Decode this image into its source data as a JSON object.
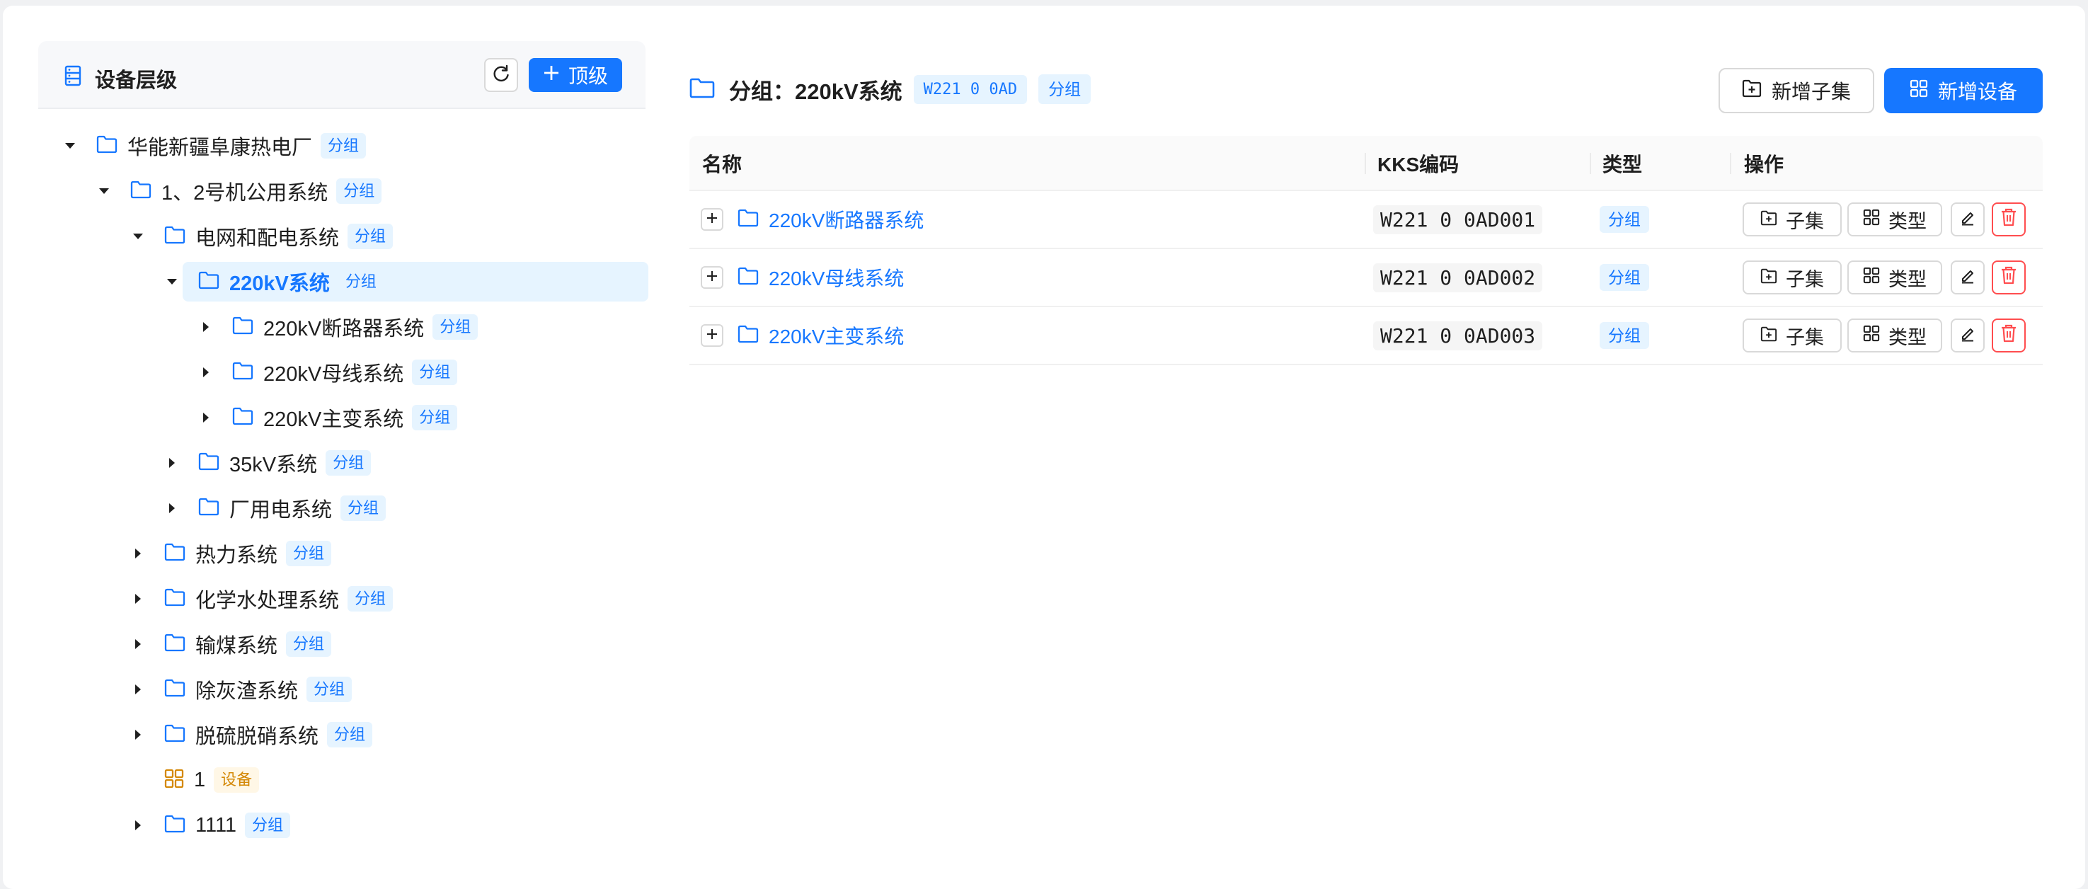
{
  "left": {
    "title": "设备层级",
    "top_button_label": "顶级"
  },
  "tree": [
    {
      "label": "华能新疆阜康热电厂",
      "tag": "分组",
      "kind": "group",
      "expanded": true,
      "depth": 0
    },
    {
      "label": "1、2号机公用系统",
      "tag": "分组",
      "kind": "group",
      "expanded": true,
      "depth": 1
    },
    {
      "label": "电网和配电系统",
      "tag": "分组",
      "kind": "group",
      "expanded": true,
      "depth": 2
    },
    {
      "label": "220kV系统",
      "tag": "分组",
      "kind": "group",
      "expanded": true,
      "depth": 3,
      "selected": true
    },
    {
      "label": "220kV断路器系统",
      "tag": "分组",
      "kind": "group",
      "expanded": false,
      "depth": 4
    },
    {
      "label": "220kV母线系统",
      "tag": "分组",
      "kind": "group",
      "expanded": false,
      "depth": 4
    },
    {
      "label": "220kV主变系统",
      "tag": "分组",
      "kind": "group",
      "expanded": false,
      "depth": 4
    },
    {
      "label": "35kV系统",
      "tag": "分组",
      "kind": "group",
      "expanded": false,
      "depth": 3
    },
    {
      "label": "厂用电系统",
      "tag": "分组",
      "kind": "group",
      "expanded": false,
      "depth": 3
    },
    {
      "label": "热力系统",
      "tag": "分组",
      "kind": "group",
      "expanded": false,
      "depth": 2
    },
    {
      "label": "化学水处理系统",
      "tag": "分组",
      "kind": "group",
      "expanded": false,
      "depth": 2
    },
    {
      "label": "输煤系统",
      "tag": "分组",
      "kind": "group",
      "expanded": false,
      "depth": 2
    },
    {
      "label": "除灰渣系统",
      "tag": "分组",
      "kind": "group",
      "expanded": false,
      "depth": 2
    },
    {
      "label": "脱硫脱硝系统",
      "tag": "分组",
      "kind": "group",
      "expanded": false,
      "depth": 2
    },
    {
      "label": "1",
      "tag": "设备",
      "kind": "device",
      "expanded": null,
      "depth": 2
    },
    {
      "label": "1111",
      "tag": "分组",
      "kind": "group",
      "expanded": false,
      "depth": 2
    }
  ],
  "header": {
    "title": "分组：220kV系统",
    "code": "W221 0 0AD",
    "tag": "分组",
    "add_child_label": "新增子集",
    "add_device_label": "新增设备"
  },
  "table": {
    "columns": [
      "名称",
      "KKS编码",
      "类型",
      "操作"
    ],
    "rows": [
      {
        "name": "220kV断路器系统",
        "kks": "W221 0 0AD001",
        "type": "分组"
      },
      {
        "name": "220kV母线系统",
        "kks": "W221 0 0AD002",
        "type": "分组"
      },
      {
        "name": "220kV主变系统",
        "kks": "W221 0 0AD003",
        "type": "分组"
      }
    ],
    "op_child_label": "子集",
    "op_type_label": "类型"
  },
  "colors": {
    "primary": "#1677ff",
    "danger": "#ff4d4f",
    "device": "#d48806"
  }
}
